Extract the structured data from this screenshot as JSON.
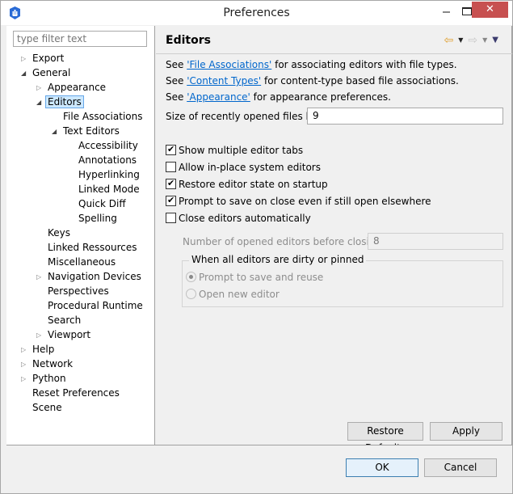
{
  "window": {
    "title": "Preferences",
    "close_label": "✕",
    "accent_close": "#c75050"
  },
  "filter": {
    "placeholder": "type filter text",
    "value": ""
  },
  "tree": [
    {
      "label": "Export",
      "level": 0,
      "twisty": "collapsed"
    },
    {
      "label": "General",
      "level": 0,
      "twisty": "expanded"
    },
    {
      "label": "Appearance",
      "level": 1,
      "twisty": "collapsed"
    },
    {
      "label": "Editors",
      "level": 1,
      "twisty": "expanded",
      "selected": true
    },
    {
      "label": "File Associations",
      "level": 2,
      "twisty": "none"
    },
    {
      "label": "Text Editors",
      "level": 2,
      "twisty": "expanded"
    },
    {
      "label": "Accessibility",
      "level": 3,
      "twisty": "none"
    },
    {
      "label": "Annotations",
      "level": 3,
      "twisty": "none"
    },
    {
      "label": "Hyperlinking",
      "level": 3,
      "twisty": "none"
    },
    {
      "label": "Linked Mode",
      "level": 3,
      "twisty": "none"
    },
    {
      "label": "Quick Diff",
      "level": 3,
      "twisty": "none"
    },
    {
      "label": "Spelling",
      "level": 3,
      "twisty": "none"
    },
    {
      "label": "Keys",
      "level": 1,
      "twisty": "none"
    },
    {
      "label": "Linked Ressources",
      "level": 1,
      "twisty": "none"
    },
    {
      "label": "Miscellaneous",
      "level": 1,
      "twisty": "none"
    },
    {
      "label": "Navigation Devices",
      "level": 1,
      "twisty": "collapsed"
    },
    {
      "label": "Perspectives",
      "level": 1,
      "twisty": "none"
    },
    {
      "label": "Procedural Runtime",
      "level": 1,
      "twisty": "none"
    },
    {
      "label": "Search",
      "level": 1,
      "twisty": "none"
    },
    {
      "label": "Viewport",
      "level": 1,
      "twisty": "collapsed"
    },
    {
      "label": "Help",
      "level": 0,
      "twisty": "collapsed"
    },
    {
      "label": "Network",
      "level": 0,
      "twisty": "collapsed"
    },
    {
      "label": "Python",
      "level": 0,
      "twisty": "collapsed"
    },
    {
      "label": "Reset Preferences",
      "level": 0,
      "twisty": "none"
    },
    {
      "label": "Scene",
      "level": 0,
      "twisty": "none"
    }
  ],
  "page": {
    "title": "Editors",
    "nav": {
      "back_icon": "⇦",
      "forward_icon": "⇨",
      "dropdown_icon": "▼",
      "back_color": "#e0a030",
      "forward_color": "#c8c8c8",
      "menu_color": "#3c3c6e"
    },
    "links": [
      {
        "prefix": "See ",
        "link": "'File Associations'",
        "suffix": " for associating editors with file types."
      },
      {
        "prefix": "See ",
        "link": "'Content Types'",
        "suffix": " for content-type based file associations."
      },
      {
        "prefix": "See ",
        "link": "'Appearance'",
        "suffix": " for appearance preferences."
      }
    ],
    "recent_files": {
      "label": "Size of recently opened files list:",
      "value": "9"
    },
    "checkboxes": [
      {
        "label": "Show multiple editor tabs",
        "checked": true
      },
      {
        "label": "Allow in-place system editors",
        "checked": false
      },
      {
        "label": "Restore editor state on startup",
        "checked": true
      },
      {
        "label": "Prompt to save on close even if still open elsewhere",
        "checked": true
      },
      {
        "label": "Close editors automatically",
        "checked": false
      }
    ],
    "opened_editors": {
      "label": "Number of opened editors before closing:",
      "value": "8"
    },
    "group": {
      "title": "When all editors are dirty or pinned",
      "options": [
        {
          "label": "Prompt to save and reuse",
          "selected": true
        },
        {
          "label": "Open new editor",
          "selected": false
        }
      ]
    },
    "buttons": {
      "restore_defaults": "Restore Defaults",
      "apply": "Apply"
    }
  },
  "dialog_buttons": {
    "ok": "OK",
    "cancel": "Cancel"
  }
}
